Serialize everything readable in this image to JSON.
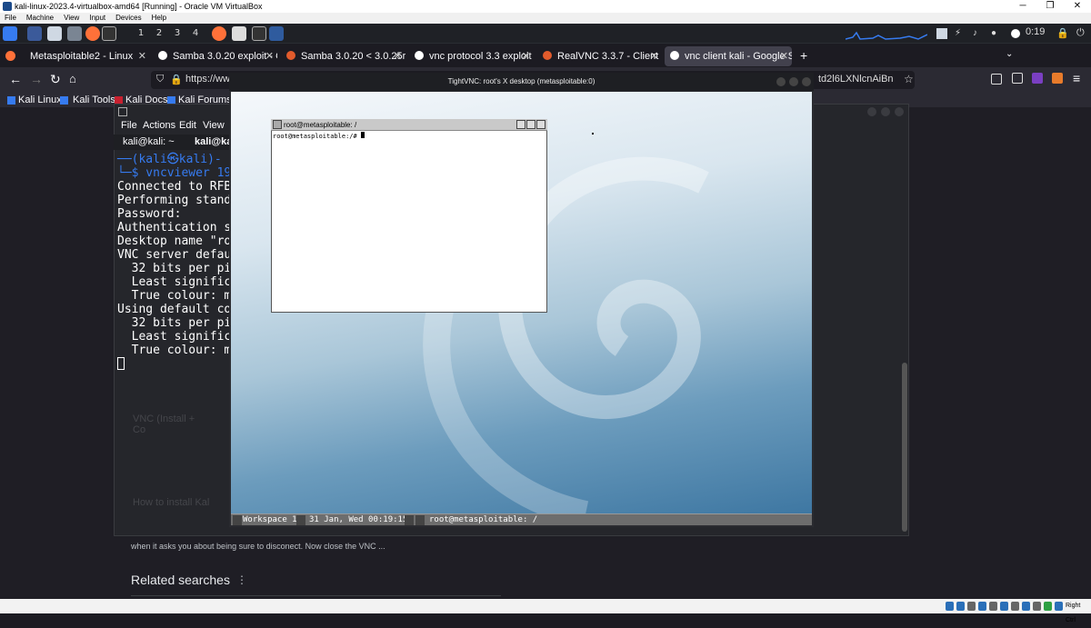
{
  "vbox": {
    "title": "kali-linux-2023.4-virtualbox-amd64 [Running] - Oracle VM VirtualBox",
    "menu": [
      "File",
      "Machine",
      "View",
      "Input",
      "Devices",
      "Help"
    ],
    "host_key": "Right Ctrl"
  },
  "panel": {
    "workspaces": [
      "1",
      "2",
      "3",
      "4"
    ],
    "clock": "0:19"
  },
  "browser": {
    "tabs": [
      {
        "label": "Metasploitable2 - Linux"
      },
      {
        "label": "Samba 3.0.20 exploit - Go"
      },
      {
        "label": "Samba 3.0.20 < 3.0.25rc3"
      },
      {
        "label": "vnc protocol 3.3 exploit - "
      },
      {
        "label": "RealVNC 3.3.7 - Client Bu"
      },
      {
        "label": "vnc client kali - Google Se"
      }
    ],
    "new_tab": "+",
    "url": "https://ww",
    "url_tail": "td2l6LXNlcnAiBnZuY",
    "bookmarks": [
      "Kali Linux",
      "Kali Tools",
      "Kali Docs",
      "Kali Forums"
    ],
    "page_snippet": "when it asks you about being sure to disconect. Now close the VNC ...",
    "related": "Related searches",
    "faded1": "VNC (Install + Co",
    "faded2": "How to install Kal"
  },
  "terminal": {
    "menu": [
      "File",
      "Actions",
      "Edit",
      "View"
    ],
    "tabs": [
      "kali@kali: ~",
      "kali@kal"
    ],
    "prompt_user": "──(kali㉿kali)-",
    "prompt_cmd": "└─$ vncviewer 192",
    "lines": [
      "Connected to RFB",
      "Performing standa",
      "Password:",
      "Authentication su",
      "Desktop name \"roo",
      "VNC server defaul",
      "  32 bits per pix",
      "  Least significa",
      "  True colour: ma",
      "Using default col",
      "  32 bits per pix",
      "  Least significa",
      "  True colour: ma"
    ]
  },
  "vnc": {
    "title": "TightVNC: root's X desktop (metasploitable:0)",
    "xterm_title": "root@metasploitable: /",
    "xterm_line": "root@metasploitable:/# ",
    "workspace": "Workspace 1",
    "date": "31 Jan, Wed 00:19:15",
    "task": "root@metasploitable: /"
  },
  "colors": {
    "accent": "#1a73e8",
    "kali_blue": "#367bf0",
    "firefox": "#ff7139"
  }
}
